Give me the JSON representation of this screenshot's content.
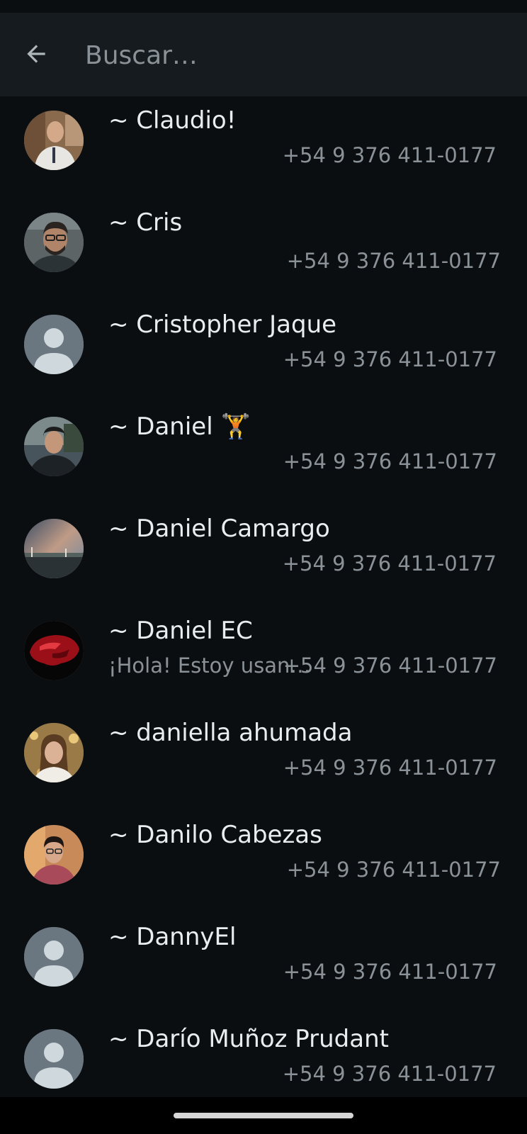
{
  "search": {
    "placeholder": "Buscar…",
    "back_icon": "arrow-left-icon"
  },
  "contacts": [
    {
      "name": "~ Claudio!",
      "phone": "+54 9 376 411-0177",
      "status": "",
      "avatar": "photo"
    },
    {
      "name": "~ Cris",
      "phone": "+54 9 376 411-0177",
      "status": "",
      "avatar": "photo"
    },
    {
      "name": "~ Cristopher Jaque",
      "phone": "+54 9 376 411-0177",
      "status": "",
      "avatar": "default"
    },
    {
      "name": "~ Daniel 🏋",
      "phone": "+54 9 376 411-0177",
      "status": "",
      "avatar": "photo"
    },
    {
      "name": "~ Daniel Camargo",
      "phone": "+54 9 376 411-0177",
      "status": "",
      "avatar": "photo"
    },
    {
      "name": "~ Daniel EC",
      "phone": "+54 9 376 411-0177",
      "status": "¡Hola! Estoy usando WhatsApp.",
      "avatar": "photo"
    },
    {
      "name": "~ daniella ahumada",
      "phone": "+54 9 376 411-0177",
      "status": "",
      "avatar": "photo"
    },
    {
      "name": "~ Danilo Cabezas",
      "phone": "+54 9 376 411-0177",
      "status": "",
      "avatar": "photo"
    },
    {
      "name": "~ DannyEl",
      "phone": "+54 9 376 411-0177",
      "status": "",
      "avatar": "default"
    },
    {
      "name": "~ Darío Muñoz Prudant",
      "phone": "+54 9 376 411-0177",
      "status": "",
      "avatar": "default"
    }
  ],
  "colors": {
    "background": "#0b0e11",
    "header": "#161b1f",
    "primary_text": "#e9edef",
    "secondary_text": "#8a9298",
    "default_avatar_bg": "#6a7781"
  }
}
